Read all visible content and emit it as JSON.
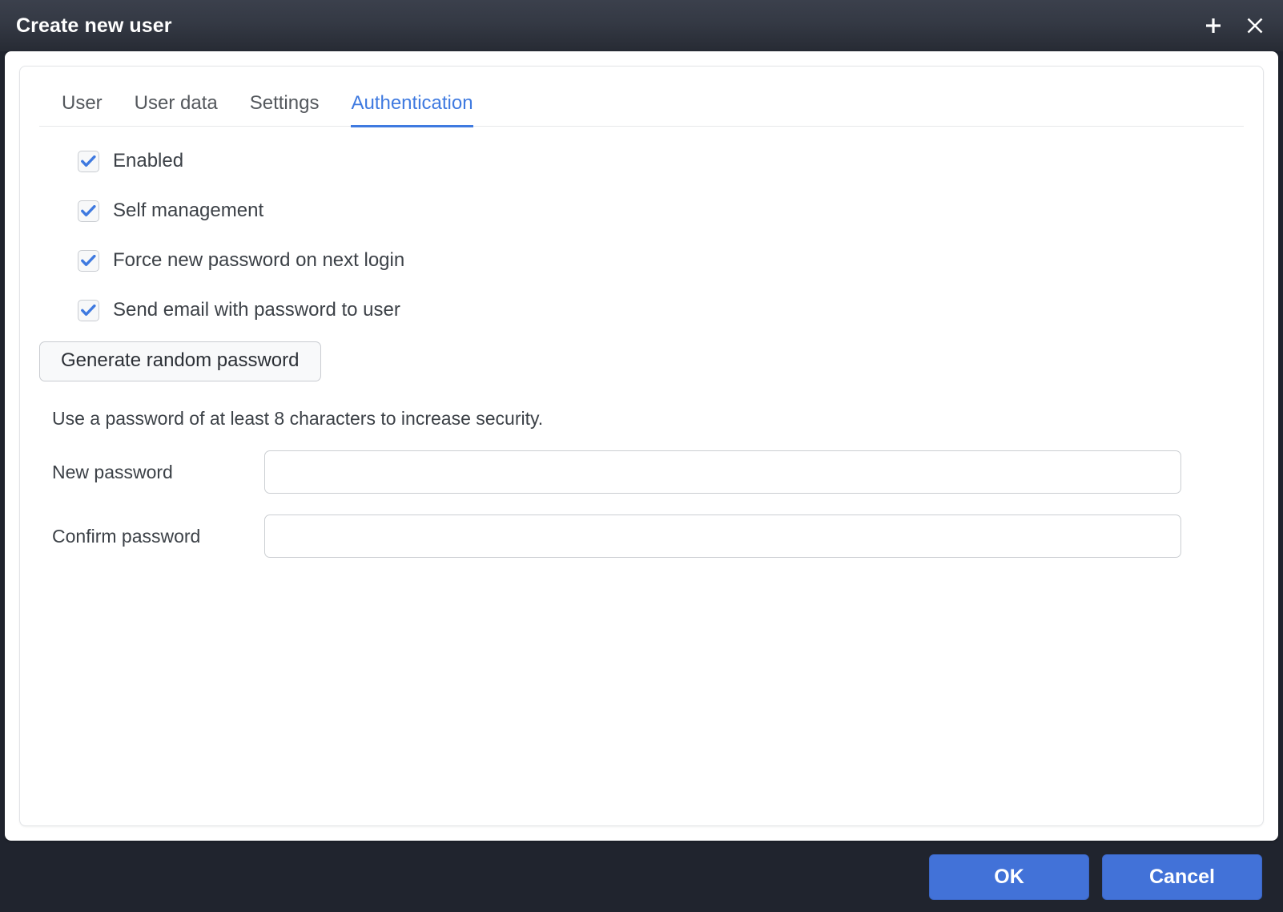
{
  "titlebar": {
    "title": "Create new user",
    "add_icon": "plus-icon",
    "close_icon": "close-icon"
  },
  "tabs": [
    {
      "label": "User",
      "active": false
    },
    {
      "label": "User data",
      "active": false
    },
    {
      "label": "Settings",
      "active": false
    },
    {
      "label": "Authentication",
      "active": true
    }
  ],
  "authentication": {
    "checkboxes": [
      {
        "label": "Enabled",
        "checked": true
      },
      {
        "label": "Self management",
        "checked": true
      },
      {
        "label": "Force new password on next login",
        "checked": true
      },
      {
        "label": "Send email with password to user",
        "checked": true
      }
    ],
    "generate_button": "Generate random password",
    "hint": "Use a password of at least 8 characters to increase security.",
    "fields": [
      {
        "label": "New password",
        "value": "",
        "placeholder": ""
      },
      {
        "label": "Confirm password",
        "value": "",
        "placeholder": ""
      }
    ]
  },
  "footer": {
    "ok_label": "OK",
    "cancel_label": "Cancel"
  },
  "colors": {
    "titlebar_top": "#3b404c",
    "titlebar_bottom": "#272b34",
    "footer_bg": "#20242e",
    "accent_blue": "#3f7ae0",
    "button_blue": "#4272d8",
    "checkbox_check": "#3f7ae0",
    "text_dark": "#3c4147"
  }
}
